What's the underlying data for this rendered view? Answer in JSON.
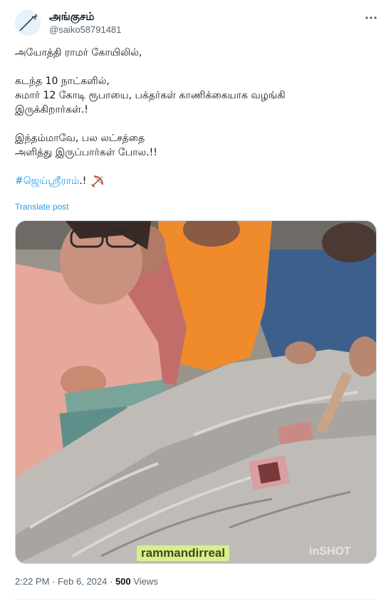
{
  "author": {
    "name": "அங்குசம்",
    "handle": "@saiko58791481",
    "avatar_icon": "spear-icon",
    "more_icon": "ellipsis-icon"
  },
  "tweet": {
    "lines": [
      "அயோத்தி ராமர் கோயிலில்,",
      "",
      "கடந்த 10 நாட்களில்,",
      "சுமார் 12 கோடி ரூபாயை, பக்தர்கள் காணிக்கையாக வழங்கி",
      "இருக்கிறார்கள்.!",
      "",
      "இந்தம்மாவே, பல லட்சத்தை",
      "அளித்து இருப்பார்கள் போல.!!",
      ""
    ],
    "hashtag": "#ஜெய்ஸ்ரீராம்",
    "hashtag_suffix": ".! ",
    "emoji_icon": "bow-and-arrow-icon",
    "translate_label": "Translate post"
  },
  "media": {
    "watermark": "rammandirreal",
    "inshot_label": "inSHOT"
  },
  "meta": {
    "time": "2:22 PM",
    "separator": " · ",
    "date": "Feb 6, 2024",
    "views_count": "500",
    "views_label": "Views"
  },
  "colors": {
    "accent": "#1d9bf0",
    "text": "#0f1419",
    "muted": "#536471",
    "border": "#cfd9de"
  }
}
